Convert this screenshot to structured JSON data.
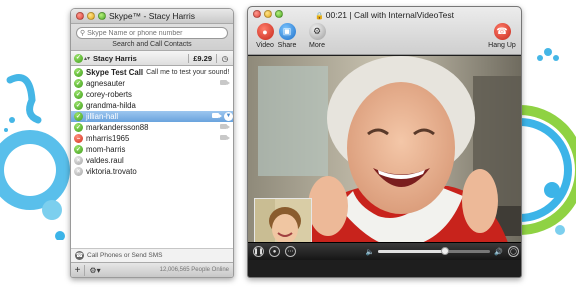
{
  "skype_window": {
    "title": "Skype™ - Stacy Harris",
    "search_placeholder": "Skype Name or phone number",
    "search_button": "Search and Call Contacts",
    "account": {
      "name": "Stacy Harris",
      "credit": "£9.29",
      "status": "online"
    },
    "contacts": [
      {
        "name": "Skype Test Call",
        "mood": "Call me to test your sound!",
        "status": "online",
        "bold": true,
        "camera": false,
        "selected": false
      },
      {
        "name": "agnesauter",
        "mood": "",
        "status": "online",
        "bold": false,
        "camera": true,
        "selected": false
      },
      {
        "name": "corey-roberts",
        "mood": "",
        "status": "online",
        "bold": false,
        "camera": false,
        "selected": false
      },
      {
        "name": "grandma-hilda",
        "mood": "",
        "status": "online",
        "bold": false,
        "camera": false,
        "selected": false
      },
      {
        "name": "jillian-hall",
        "mood": "",
        "status": "online",
        "bold": false,
        "camera": true,
        "selected": true
      },
      {
        "name": "markandersson88",
        "mood": "",
        "status": "online",
        "bold": false,
        "camera": true,
        "selected": false
      },
      {
        "name": "mharris1965",
        "mood": "",
        "status": "dnd",
        "bold": false,
        "camera": true,
        "selected": false
      },
      {
        "name": "mom-harris",
        "mood": "",
        "status": "online",
        "bold": false,
        "camera": false,
        "selected": false
      },
      {
        "name": "valdes.raul",
        "mood": "",
        "status": "offline",
        "bold": false,
        "camera": false,
        "selected": false
      },
      {
        "name": "viktoria.trovato",
        "mood": "",
        "status": "offline",
        "bold": false,
        "camera": false,
        "selected": false
      }
    ],
    "bottom_link": "Call Phones or Send SMS",
    "people_online": "12,006,565 People Online"
  },
  "call_window": {
    "title": "00:21 | Call with InternalVideoTest",
    "toolbar": {
      "video": "Video",
      "share": "Share",
      "more": "More",
      "hang_up": "Hang Up"
    },
    "volume_level": 0.6
  },
  "colors": {
    "skype_blue": "#00aff0",
    "status_online": "#3f9d1c",
    "status_dnd": "#d22f1c",
    "hang_up_red": "#c5271a",
    "selection_blue": "#6aa3dd"
  }
}
